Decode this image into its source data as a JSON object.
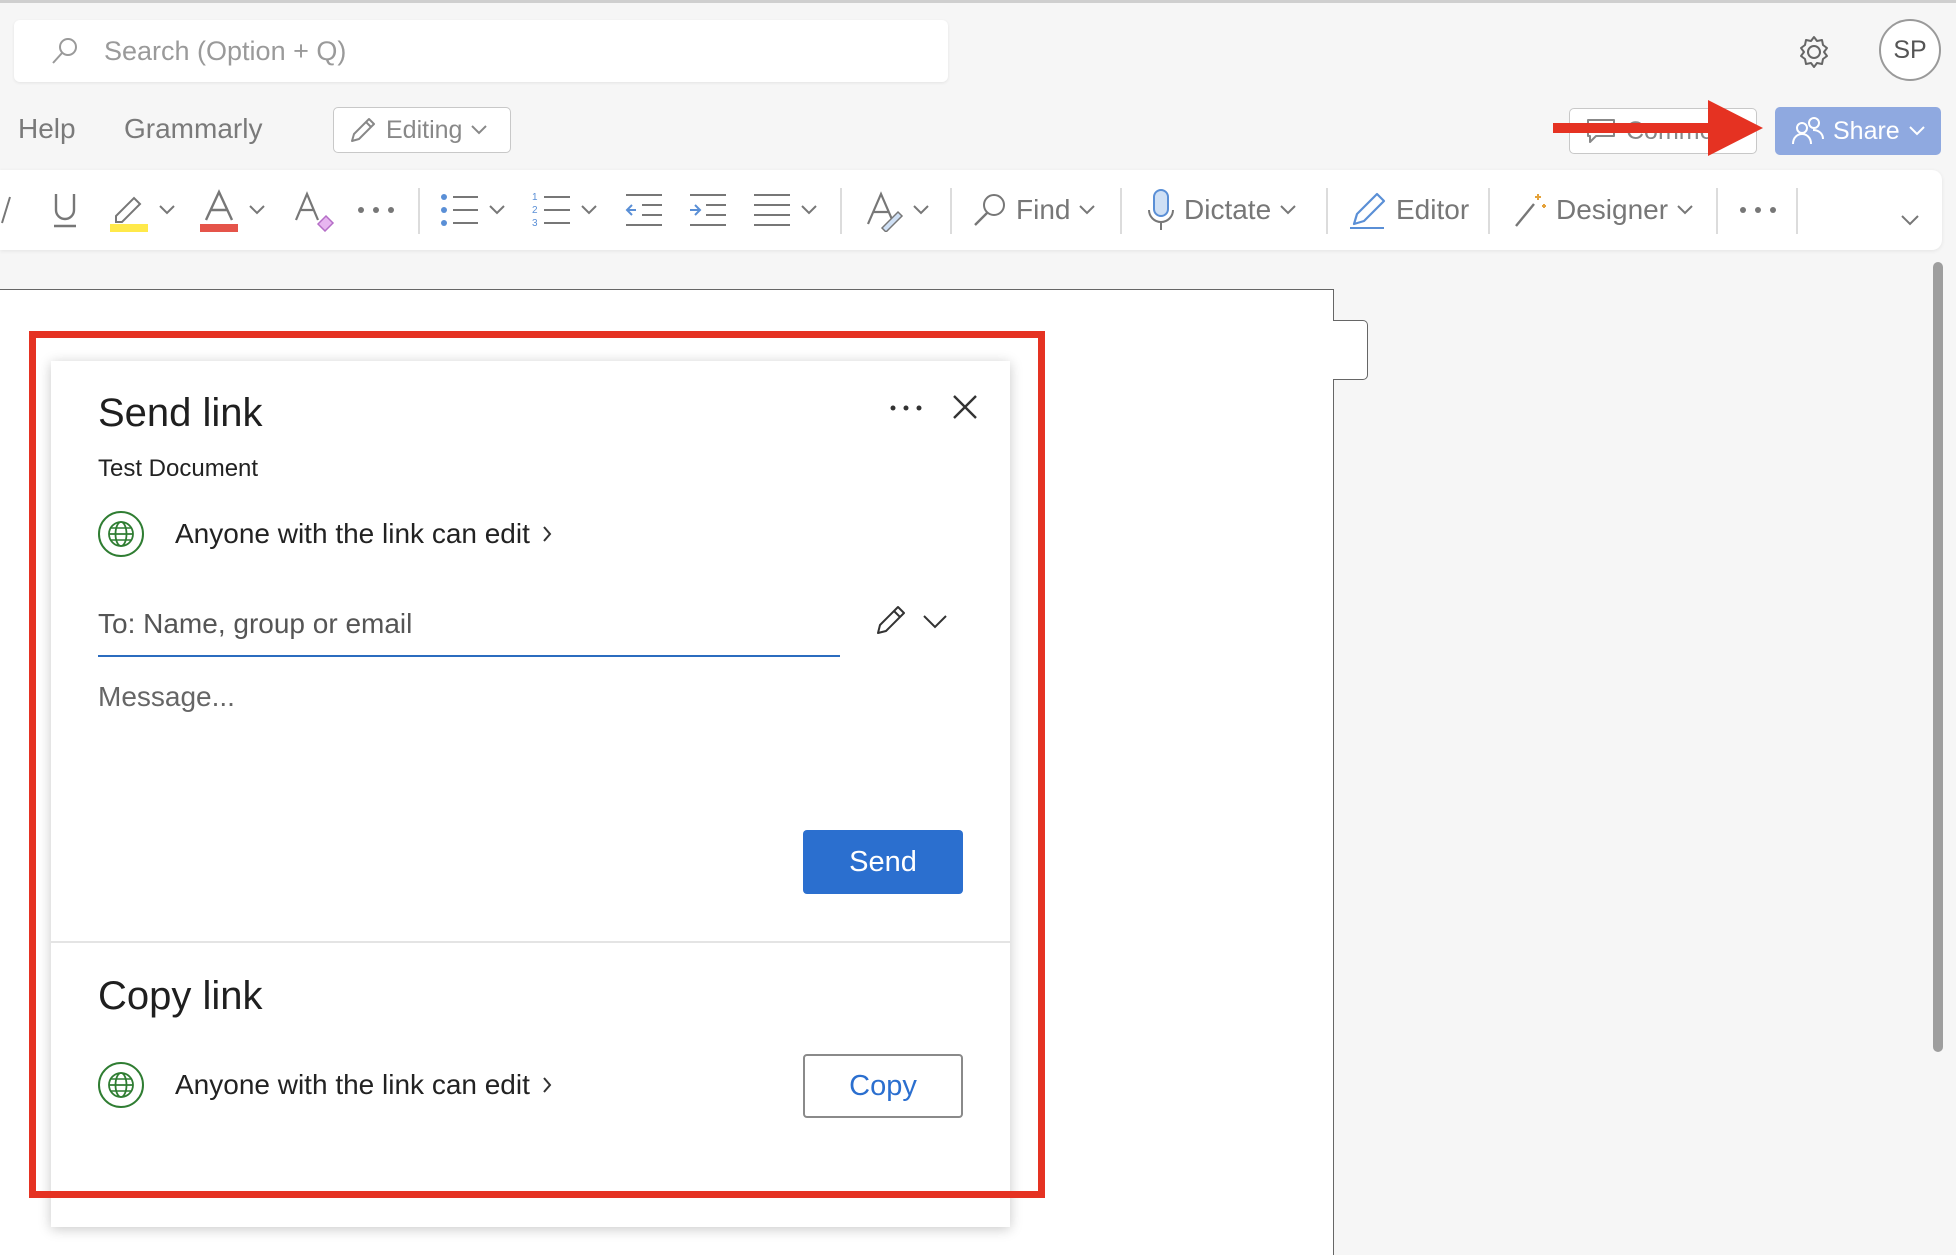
{
  "search": {
    "placeholder": "Search (Option + Q)"
  },
  "account": {
    "initials": "SP"
  },
  "menu": {
    "items": [
      "Help",
      "Grammarly"
    ],
    "mode_label": "Editing"
  },
  "actions": {
    "comments_label": "Comme",
    "share_label": "Share"
  },
  "ribbon": {
    "find_label": "Find",
    "dictate_label": "Dictate",
    "editor_label": "Editor",
    "designer_label": "Designer",
    "highlight_color": "#ffe94a",
    "font_color": "#e5544a"
  },
  "dialog": {
    "title": "Send link",
    "file_name": "Test Document",
    "permission": "Anyone with the link can edit",
    "to_placeholder": "To: Name, group or email",
    "message_placeholder": "Message...",
    "send_label": "Send",
    "copy_title": "Copy link",
    "copy_permission": "Anyone with the link can edit",
    "copy_label": "Copy"
  },
  "colors": {
    "accent": "#2b6fcf",
    "share_button": "#8fa9e0",
    "annotation_red": "#e53222",
    "globe_green": "#2f7d32"
  }
}
